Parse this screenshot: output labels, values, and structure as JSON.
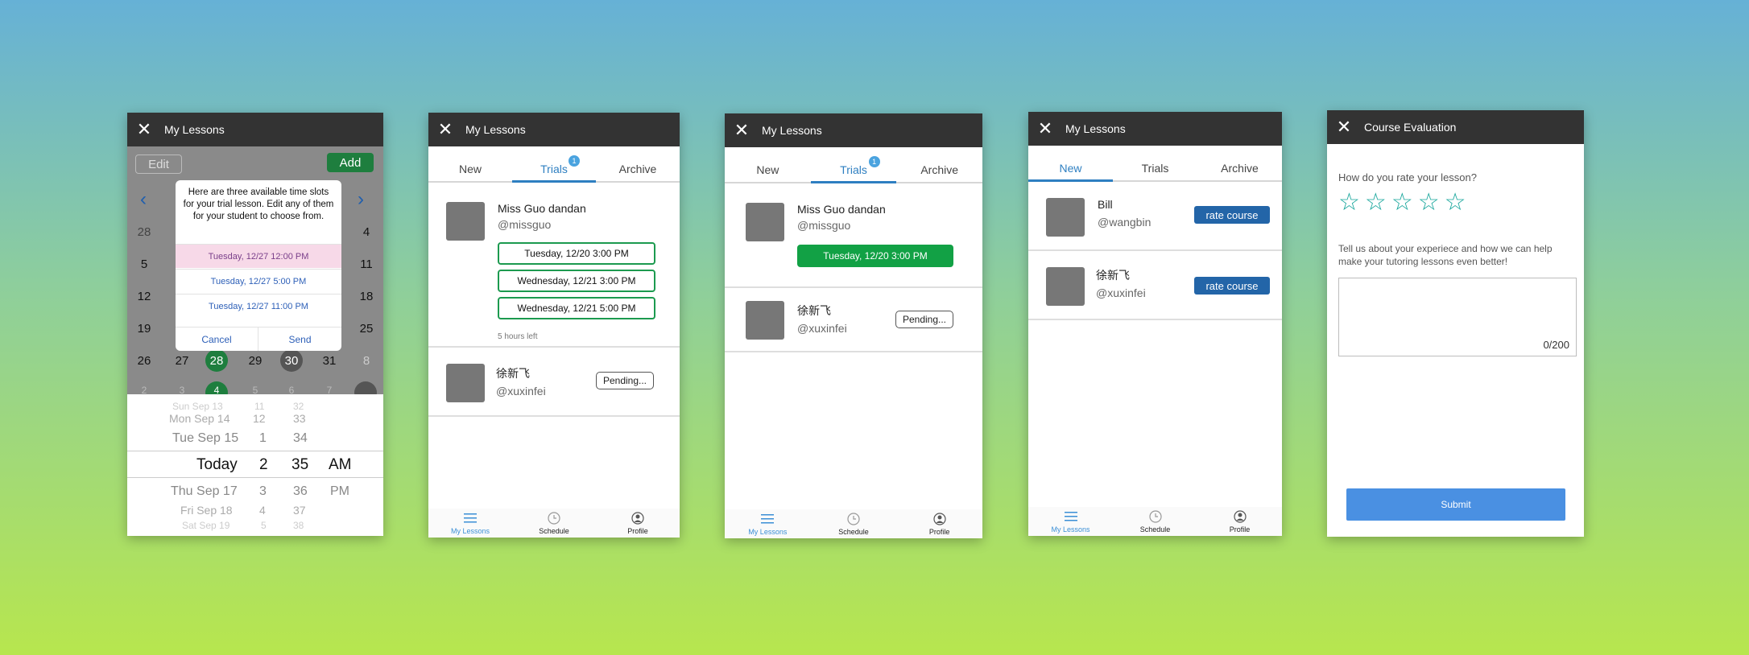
{
  "screen1": {
    "title": "My Lessons",
    "edit_label": "Edit",
    "add_label": "Add",
    "prev_icon": "chevron-left-icon",
    "next_icon": "chevron-right-icon",
    "left_numbers": [
      "28",
      "5",
      "12",
      "19",
      "26",
      "2"
    ],
    "right_numbers": [
      "4",
      "11",
      "18",
      "25",
      "1",
      "8"
    ],
    "bottom_row": [
      "27",
      "28",
      "29",
      "30",
      "31"
    ],
    "partial_row": [
      "3",
      "4",
      "5",
      "6",
      "7"
    ],
    "popup": {
      "message": "Here are three available time slots for your trial lesson. Edit any of them for your student to choose from.",
      "options": [
        "Tuesday, 12/27 12:00 PM",
        "Tuesday, 12/27 5:00 PM",
        "Tuesday, 12/27 11:00 PM"
      ],
      "cancel": "Cancel",
      "send": "Send"
    },
    "picker": {
      "rows": [
        {
          "date": "Sun Sep 13",
          "hour": "11",
          "min": "32",
          "ampm": ""
        },
        {
          "date": "Mon Sep 14",
          "hour": "12",
          "min": "33",
          "ampm": ""
        },
        {
          "date": "Tue Sep 15",
          "hour": "1",
          "min": "34",
          "ampm": ""
        },
        {
          "date": "Today",
          "hour": "2",
          "min": "35",
          "ampm": "AM"
        },
        {
          "date": "Thu Sep 17",
          "hour": "3",
          "min": "36",
          "ampm": "PM"
        },
        {
          "date": "Fri Sep 18",
          "hour": "4",
          "min": "37",
          "ampm": ""
        },
        {
          "date": "Sat Sep 19",
          "hour": "5",
          "min": "38",
          "ampm": ""
        }
      ]
    }
  },
  "tabs": {
    "new": "New",
    "trials": "Trials",
    "archive": "Archive",
    "trials_badge": "1"
  },
  "nav": {
    "lessons": "My Lessons",
    "schedule": "Schedule",
    "profile": "Profile"
  },
  "screen2": {
    "title": "My Lessons",
    "teacher": {
      "name": "Miss Guo dandan",
      "handle": "@missguo"
    },
    "slots": [
      "Tuesday, 12/20 3:00 PM",
      "Wednesday, 12/21 3:00 PM",
      "Wednesday, 12/21 5:00 PM"
    ],
    "time_left": "5 hours left",
    "student": {
      "name": "徐新飞",
      "handle": "@xuxinfei"
    },
    "pending": "Pending..."
  },
  "screen3": {
    "title": "My Lessons",
    "teacher": {
      "name": "Miss Guo dandan",
      "handle": "@missguo"
    },
    "slot": "Tuesday, 12/20 3:00 PM",
    "student": {
      "name": "徐新飞",
      "handle": "@xuxinfei"
    },
    "pending": "Pending..."
  },
  "screen4": {
    "title": "My Lessons",
    "items": [
      {
        "name": "Bill",
        "handle": "@wangbin",
        "action": "rate course"
      },
      {
        "name": "徐新飞",
        "handle": "@xuxinfei",
        "action": "rate course"
      }
    ]
  },
  "screen5": {
    "title": "Course Evaluation",
    "question": "How do you rate your lesson?",
    "stars": 5,
    "prompt": "Tell us about your experiece and how we can help make your tutoring lessons even better!",
    "counter": "0/200",
    "submit": "Submit"
  },
  "colors": {
    "accent_blue": "#2e7fc1",
    "green": "#12a145",
    "header": "#333333",
    "rate_blue": "#2365a8",
    "star_teal": "#1aa79d"
  }
}
